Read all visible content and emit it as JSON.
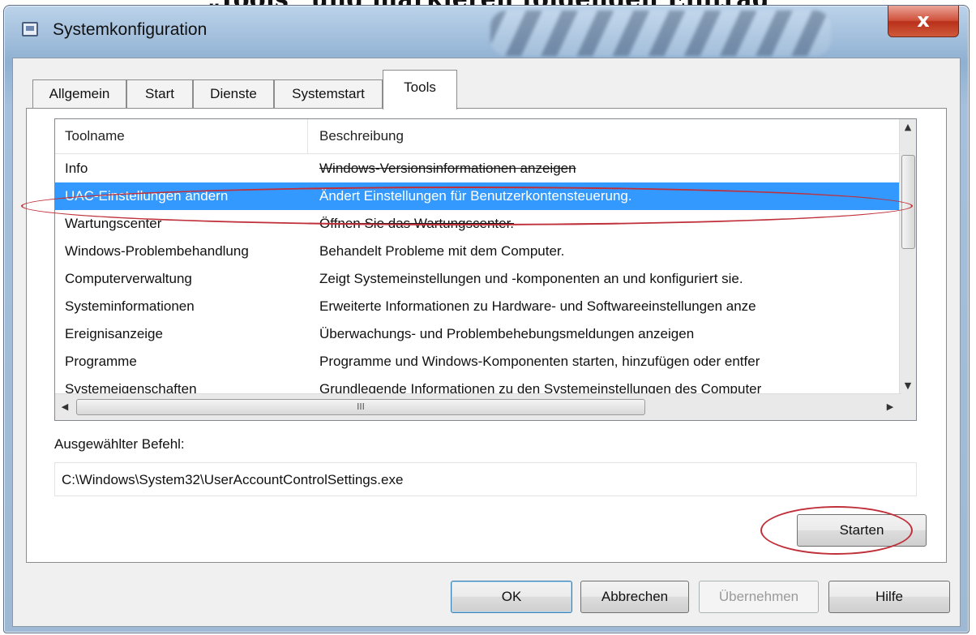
{
  "page": {
    "heading": "„Tools“ und markieren folgenden Eintrag"
  },
  "window": {
    "title": "Systemkonfiguration",
    "close_label": "x"
  },
  "tabs": [
    {
      "label": "Allgemein"
    },
    {
      "label": "Start"
    },
    {
      "label": "Dienste"
    },
    {
      "label": "Systemstart"
    },
    {
      "label": "Tools",
      "active": true
    }
  ],
  "listview": {
    "columns": [
      "Toolname",
      "Beschreibung"
    ],
    "selected_index": 1,
    "rows": [
      [
        "Info",
        "Windows-Versionsinformationen anzeigen"
      ],
      [
        "UAC-Einstellungen ändern",
        "Ändert Einstellungen für Benutzerkontensteuerung."
      ],
      [
        "Wartungscenter",
        "Öffnen Sie das Wartungscenter."
      ],
      [
        "Windows-Problembehandlung",
        "Behandelt Probleme mit dem Computer."
      ],
      [
        "Computerverwaltung",
        "Zeigt Systemeinstellungen und -komponenten an und konfiguriert sie."
      ],
      [
        "Systeminformationen",
        "Erweiterte Informationen zu Hardware- und Softwareeinstellungen anze"
      ],
      [
        "Ereignisanzeige",
        "Überwachungs- und Problembehebungsmeldungen anzeigen"
      ],
      [
        "Programme",
        "Programme und Windows-Komponenten starten, hinzufügen oder entfer"
      ],
      [
        "Systemeigenschaften",
        "Grundlegende Informationen zu den Systemeinstellungen des Computer"
      ]
    ],
    "hscroll_grip": "III"
  },
  "command": {
    "label": "Ausgewählter Befehl:",
    "value": "C:\\Windows\\System32\\UserAccountControlSettings.exe"
  },
  "buttons": {
    "start": "Starten",
    "ok": "OK",
    "cancel": "Abbrechen",
    "apply": "Übernehmen",
    "help": "Hilfe"
  },
  "colors": {
    "selection": "#3399ff",
    "annotation": "#c0303a",
    "close_button": "#c8432b"
  }
}
